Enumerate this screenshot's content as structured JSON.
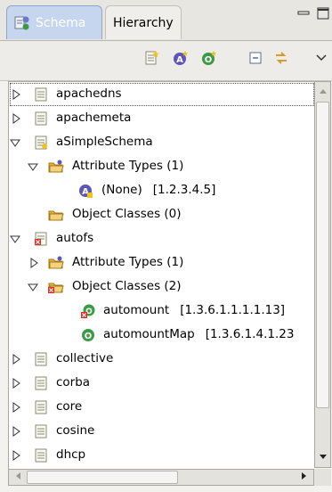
{
  "tabs": [
    {
      "label": "Schema",
      "active": true
    },
    {
      "label": "Hierarchy",
      "active": false
    }
  ],
  "toolbar": {
    "buttons": [
      "new-schema-icon",
      "new-attribute-type-icon",
      "new-object-class-icon",
      "collapse-all-icon",
      "link-with-editor-icon",
      "view-menu-icon"
    ]
  },
  "tree": {
    "nodes": [
      {
        "label": "apachedns",
        "oid": "",
        "state": "collapsed"
      },
      {
        "label": "apachemeta",
        "oid": "",
        "state": "collapsed"
      },
      {
        "label": "aSimpleSchema",
        "oid": "",
        "state": "expanded"
      },
      {
        "label": "Attribute Types (1)",
        "oid": "",
        "state": "expanded"
      },
      {
        "label": "(None)",
        "oid": "[1.2.3.4.5]",
        "state": "leaf"
      },
      {
        "label": "Object Classes (0)",
        "oid": "",
        "state": "leaf"
      },
      {
        "label": "autofs",
        "oid": "",
        "state": "expanded"
      },
      {
        "label": "Attribute Types (1)",
        "oid": "",
        "state": "collapsed"
      },
      {
        "label": "Object Classes (2)",
        "oid": "",
        "state": "expanded"
      },
      {
        "label": "automount",
        "oid": "[1.3.6.1.1.1.1.13]",
        "state": "leaf"
      },
      {
        "label": "automountMap",
        "oid": "[1.3.6.1.4.1.23",
        "state": "leaf"
      },
      {
        "label": "collective",
        "oid": "",
        "state": "collapsed"
      },
      {
        "label": "corba",
        "oid": "",
        "state": "collapsed"
      },
      {
        "label": "core",
        "oid": "",
        "state": "collapsed"
      },
      {
        "label": "cosine",
        "oid": "",
        "state": "collapsed"
      },
      {
        "label": "dhcp",
        "oid": "",
        "state": "collapsed"
      }
    ]
  },
  "colors": {
    "tab_active": "#c6d6ef",
    "schema_icon": "#8a8a70",
    "folder_icon": "#e3b23c",
    "object_class_icon": "#3a9a46",
    "attribute_icon": "#5e56b8",
    "error_mark": "#d9322a"
  }
}
